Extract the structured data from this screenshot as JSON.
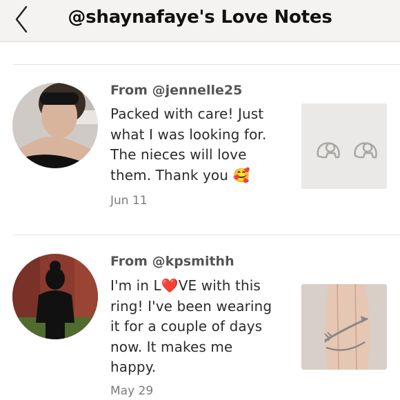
{
  "header": {
    "title": "@shaynafaye's Love Notes",
    "back_icon": "chevron-left-icon"
  },
  "reviews": [
    {
      "from": "From @jennelle25",
      "lines": [
        "Packed with care! Just",
        "what I was looking for.",
        "The nieces will love",
        "them. Thank you 🥰"
      ],
      "date": "Jun 11"
    },
    {
      "from": "From @kpsmithh",
      "lines": [
        "I'm in L❤️VE with this",
        "ring! I've been wearing",
        "it for a couple of days",
        "now. It makes me",
        "happy."
      ],
      "date": "May 29"
    }
  ]
}
